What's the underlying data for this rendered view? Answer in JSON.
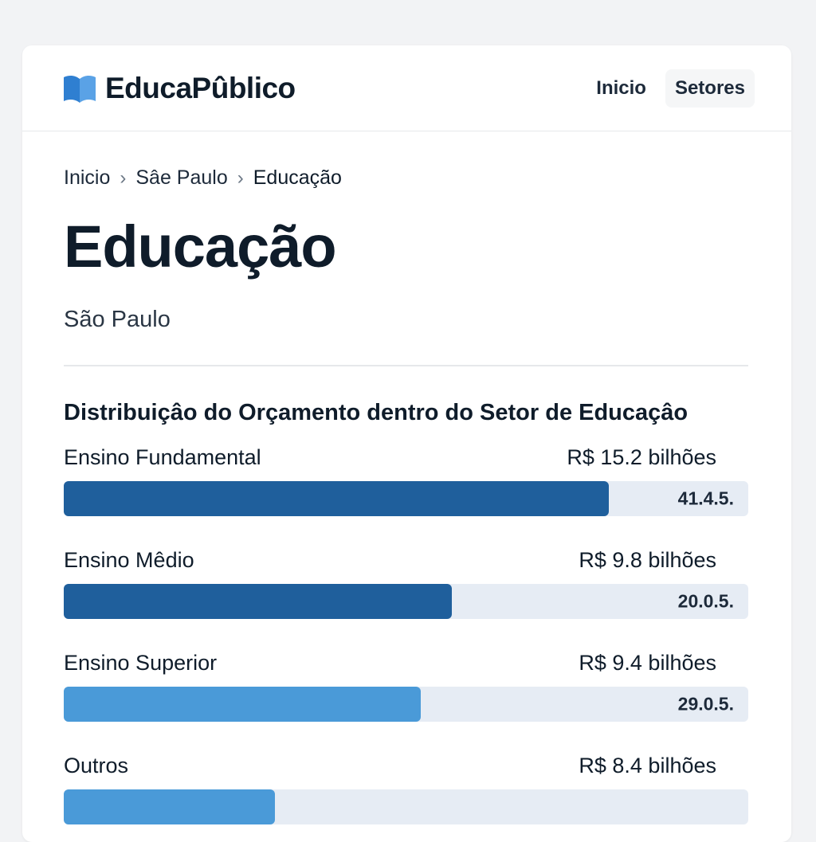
{
  "brand": {
    "name": "EducaPûblico",
    "icon": "open-book-icon",
    "color": "#2f7fd1"
  },
  "nav": {
    "items": [
      "Inicio",
      "Setores"
    ],
    "active": "Setores"
  },
  "breadcrumb": [
    "Inicio",
    "Sâe Paulo",
    "Educação"
  ],
  "page": {
    "title": "Educação",
    "subtitle": "São Paulo"
  },
  "section": {
    "title": "Distribuiçâo do Orçamento dentro do Setor de Educaçâo"
  },
  "budget_items": [
    {
      "label": "Ensino Fundamental",
      "amount": "R$ 15.2 bilhões",
      "percent_label": "41.4.5.",
      "fill": 0.796,
      "color": "#1f5f9c"
    },
    {
      "label": "Ensino Mêdio",
      "amount": "R$ 9.8 bilhões",
      "percent_label": "20.0.5.",
      "fill": 0.567,
      "color": "#1f5f9c"
    },
    {
      "label": "Ensino Superior",
      "amount": "R$ 9.4 bilhões",
      "percent_label": "29.0.5.",
      "fill": 0.522,
      "color": "#4a9ad8"
    },
    {
      "label": "Outros",
      "amount": "R$ 8.4 bilhões",
      "percent_label": "",
      "fill": 0.309,
      "color": "#4a9ad8"
    }
  ]
}
